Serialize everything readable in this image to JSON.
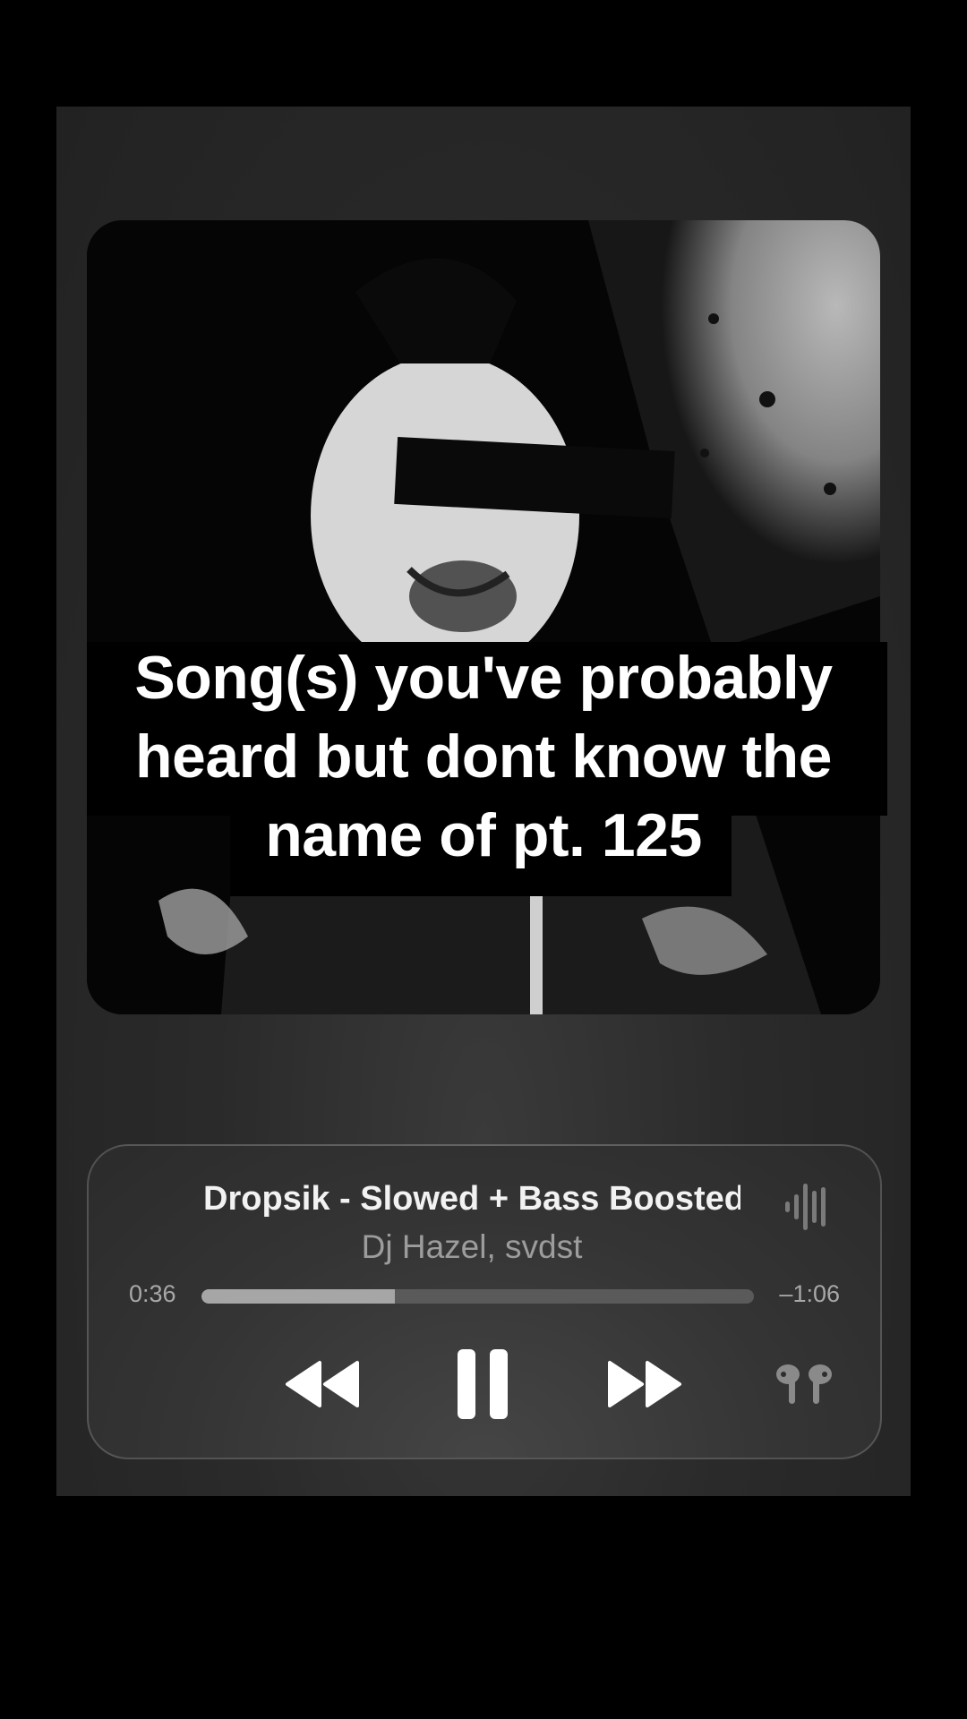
{
  "caption": {
    "line1": "Song(s) you've probably",
    "line2": "heard but dont know the",
    "line3": "name of pt. 125"
  },
  "player": {
    "title": "Dropsik - Slowed + Bass Boosted",
    "artist": "Dj Hazel, svdst",
    "elapsed": "0:36",
    "remaining": "–1:06",
    "progress": 0.35
  },
  "icons": {
    "waveform": "waveform-icon",
    "rewind": "rewind-icon",
    "pause": "pause-icon",
    "forward": "fast-forward-icon",
    "airpods": "airpods-icon"
  },
  "colors": {
    "background": "#000000",
    "card": "#2a2a2a",
    "track_fill": "#a6a6a6",
    "track_rest": "#5a5a5a",
    "artist_text": "#9c9c9c"
  }
}
